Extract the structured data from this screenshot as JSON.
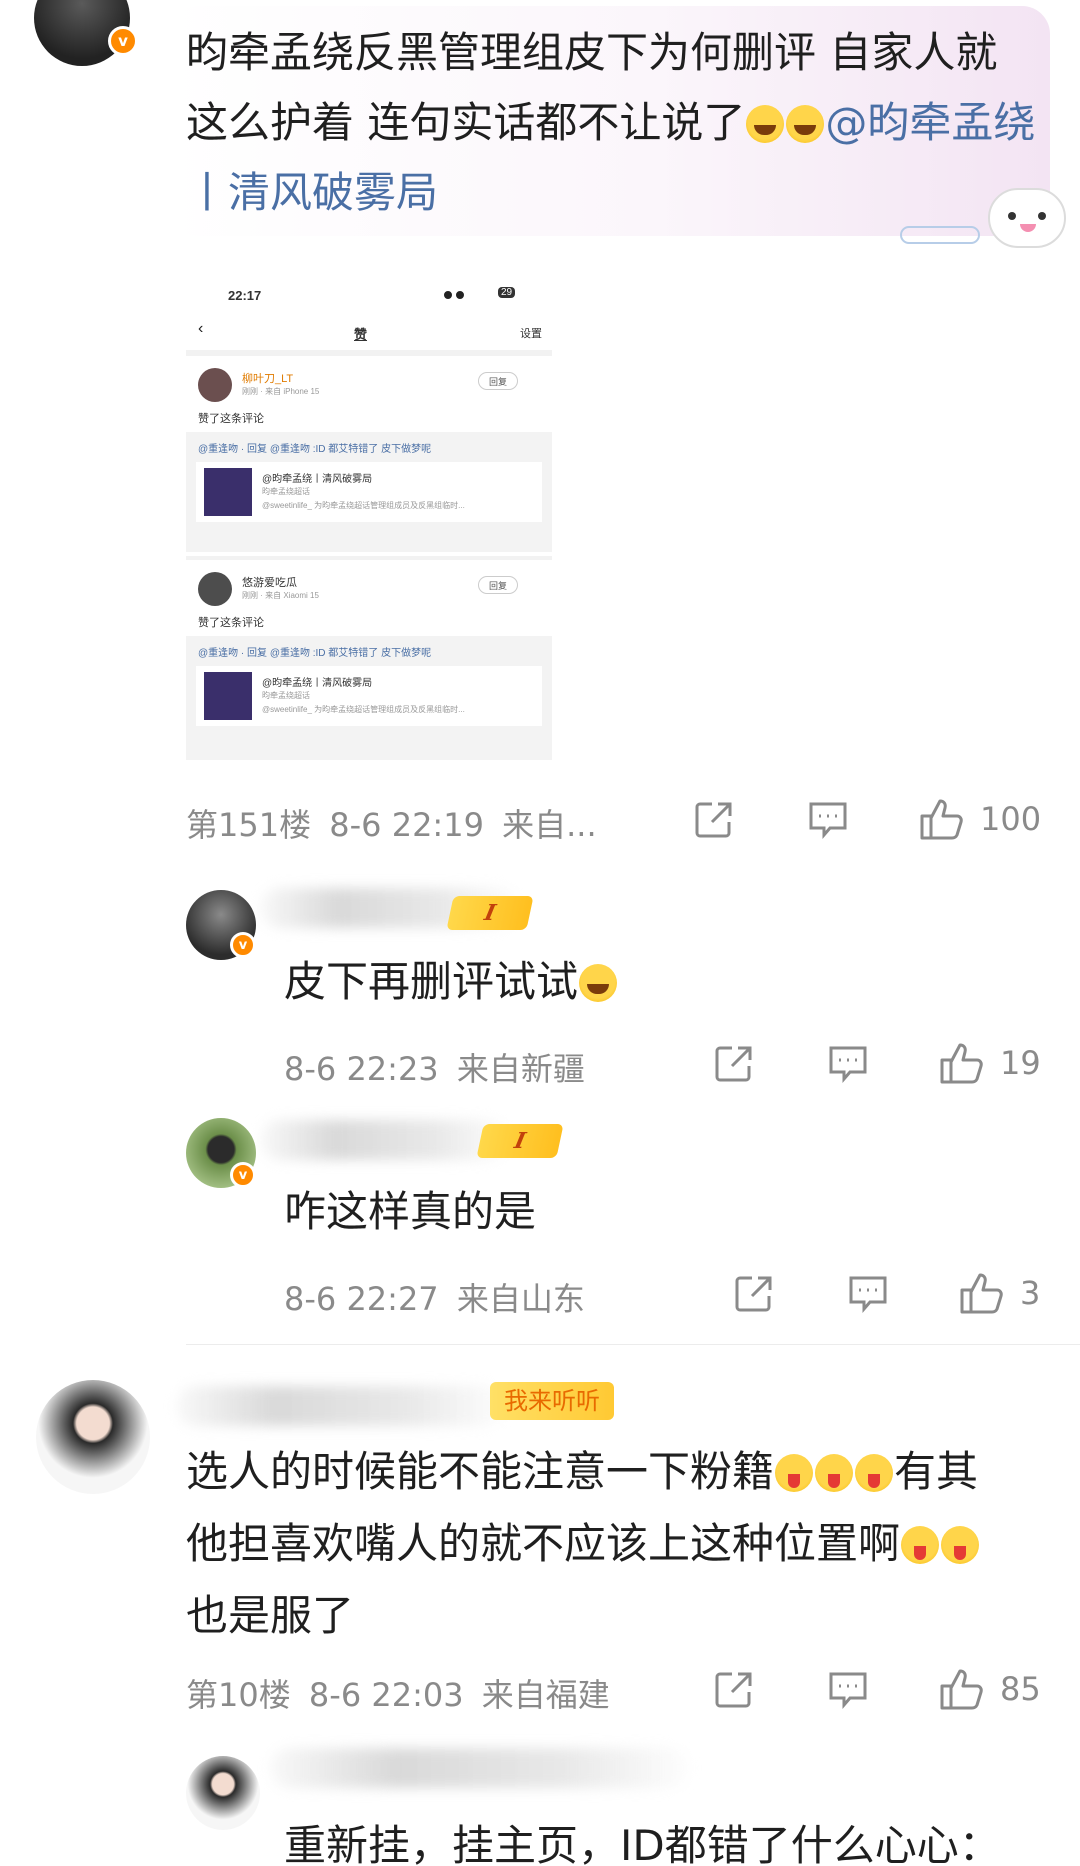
{
  "post": {
    "text_before": "昀牵孟绕反黑管理组皮下为何删评 自家人就这么护着 连句实话都不让说了",
    "mention": "@昀牵孟绕丨清风破雾局",
    "floor": "第151楼",
    "datetime": "8-6 22:19",
    "location": "来自...",
    "likes": "100"
  },
  "embedded_screenshot": {
    "status_time": "22:17",
    "battery": "29",
    "title": "赞",
    "settings": "设置",
    "items": [
      {
        "username": "柳叶刀_LT",
        "time_source": "刚刚 · 来自 iPhone 15",
        "reply_button": "回复",
        "action": "赞了这条评论",
        "quote_line": "@重逢吻 · 回复 @重逢吻 :ID 都艾特错了 皮下做梦呢",
        "card_title": "@昀牵孟绕丨清风破雾局",
        "card_sub": "昀牵孟绕超话",
        "card_desc": "@sweetinlife_ 为昀牵孟绕超话管理组成员及反黑组临时..."
      },
      {
        "username": "悠游爱吃瓜",
        "time_source": "刚刚 · 来自 Xiaomi 15",
        "reply_button": "回复",
        "action": "赞了这条评论",
        "quote_line": "@重逢吻 · 回复 @重逢吻 :ID 都艾特错了 皮下做梦呢",
        "card_title": "@昀牵孟绕丨清风破雾局",
        "card_sub": "昀牵孟绕超话",
        "card_desc": "@sweetinlife_ 为昀牵孟绕超话管理组成员及反黑组临时..."
      }
    ]
  },
  "replies": [
    {
      "text": "皮下再删评试试",
      "datetime": "8-6 22:23",
      "location": "来自新疆",
      "likes": "19",
      "level": "I"
    },
    {
      "text": "咋这样真的是",
      "datetime": "8-6 22:27",
      "location": "来自山东",
      "likes": "3",
      "level": "I"
    }
  ],
  "comment2": {
    "badge": "我来听听",
    "line1": "选人的时候能不能注意一下粉籍",
    "line1_end": "有其",
    "line2": "他担喜欢嘴人的就不应该上这种位置啊",
    "line3": "也是服了",
    "floor": "第10楼",
    "datetime": "8-6 22:03",
    "location": "来自福建",
    "likes": "85"
  },
  "reply3": {
    "text": "重新挂，挂主页，ID都错了什么心心："
  },
  "icons": {
    "share": "share-icon",
    "comment": "comment-icon",
    "like": "thumbs-up-icon",
    "verified": "verified-badge-icon"
  },
  "colors": {
    "mention": "#4a6fa5",
    "meta": "#8a8a8a",
    "verified": "#ff8a00",
    "level_tag": "#ffc62e"
  }
}
